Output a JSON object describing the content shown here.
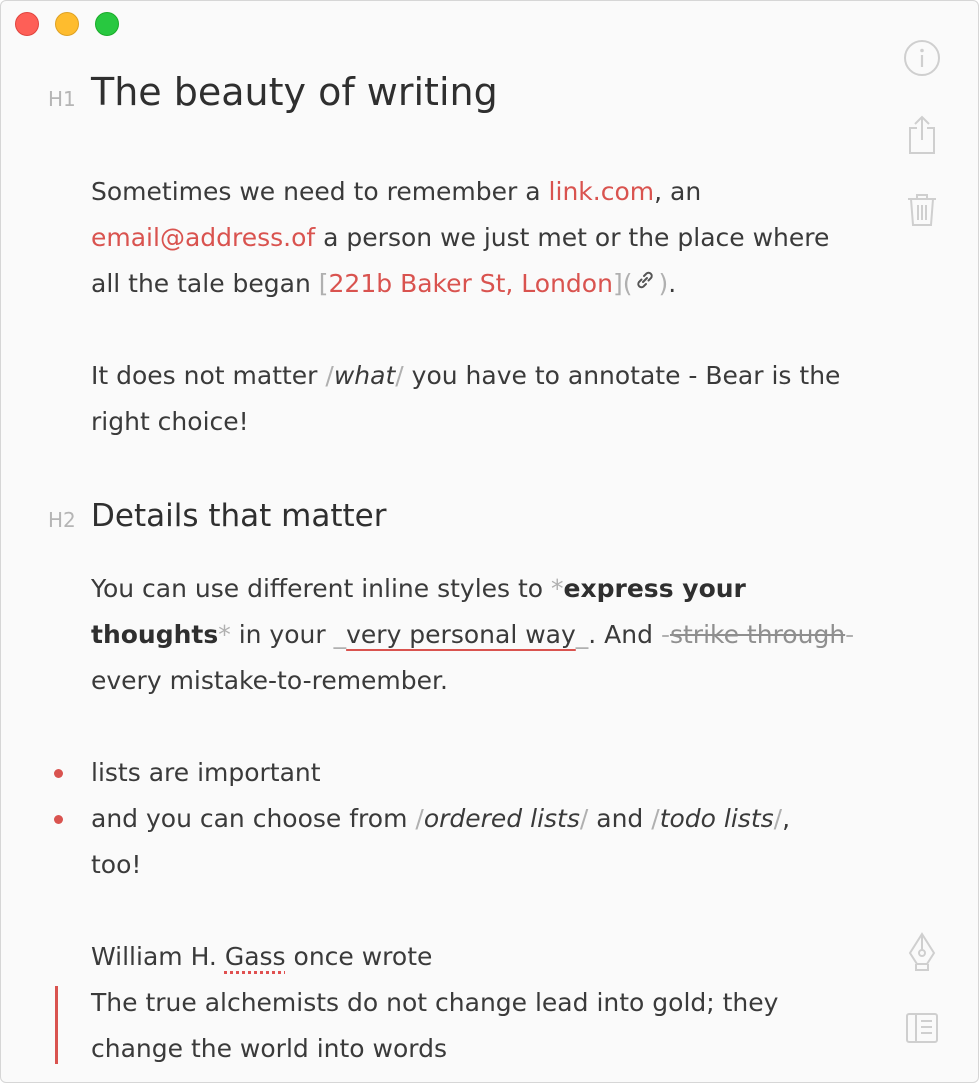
{
  "window": {
    "controls": [
      "close",
      "minimize",
      "zoom"
    ]
  },
  "heading1": {
    "marker": "H1",
    "text": "The beauty of writing"
  },
  "para1": {
    "t1": "Sometimes we need to remember a ",
    "link": "link.com",
    "t2": ", an",
    "email": "email@address.of",
    "t3": " a person we just met or the place where",
    "t4": "all the tale began ",
    "open_bracket": "[",
    "place": "221b Baker St, London",
    "close_bracket": "](",
    "close_paren": ")",
    "t5": "."
  },
  "para2": {
    "t1": "It does not matter ",
    "slash": "/",
    "ital": "what",
    "t2": " you have to annotate - Bear is the",
    "t3": "right choice!"
  },
  "heading2": {
    "marker": "H2",
    "text": "Details that matter"
  },
  "para3": {
    "t1": "You can use different inline styles to ",
    "star": "*",
    "bold1": "express your",
    "bold2": "thoughts",
    "t2": " in your ",
    "underscore": "_",
    "under": "very personal way",
    "t3": ". And ",
    "dash": "-",
    "strike": "strike through",
    "t4": "every mistake-to-remember."
  },
  "list": {
    "item1": "lists are important",
    "item2_t1": "and you can choose from ",
    "slash": "/",
    "item2_ital1": "ordered lists",
    "item2_t2": " and ",
    "item2_ital2": "todo lists",
    "item2_t3": ",",
    "item2_t4": "too!"
  },
  "quote": {
    "intro_t1": "William H. ",
    "intro_spell": "Gass",
    "intro_t2": " once wrote",
    "line1": "The true alchemists do not change lead into gold; they",
    "line2": "change the world into words"
  },
  "sidebar": {
    "icons": [
      "info-icon",
      "share-icon",
      "trash-icon",
      "pen-icon",
      "sidebar-panel-icon"
    ]
  },
  "colors": {
    "accent": "#d9534f",
    "text": "#3a3a3a",
    "muted": "#b0b0b0"
  }
}
